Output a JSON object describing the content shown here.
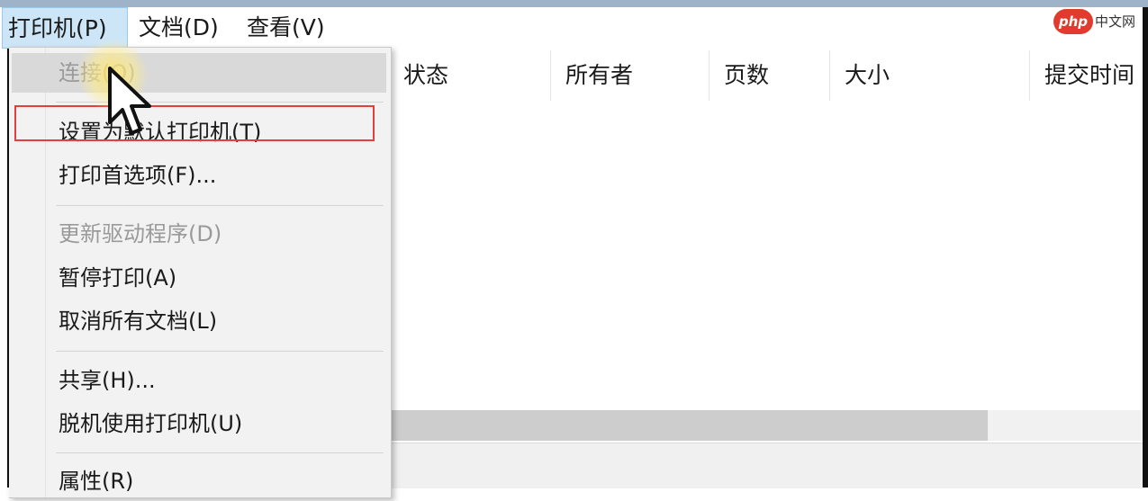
{
  "menubar": {
    "printer": "打印机(P)",
    "document": "文档(D)",
    "view": "查看(V)"
  },
  "watermark": {
    "logo": "php",
    "text": "中文网"
  },
  "columns": [
    "状态",
    "所有者",
    "页数",
    "大小",
    "提交时间"
  ],
  "printer_menu": {
    "connect": "连接(O)",
    "set_default": "设置为默认打印机(T)",
    "preferences": "打印首选项(F)...",
    "update_driver": "更新驱动程序(D)",
    "pause": "暂停打印(A)",
    "cancel_all": "取消所有文档(L)",
    "share": "共享(H)...",
    "offline": "脱机使用打印机(U)",
    "properties": "属性(R)"
  },
  "colors": {
    "highlight_border": "#e63e3e",
    "menu_active": "#cde6f7"
  }
}
